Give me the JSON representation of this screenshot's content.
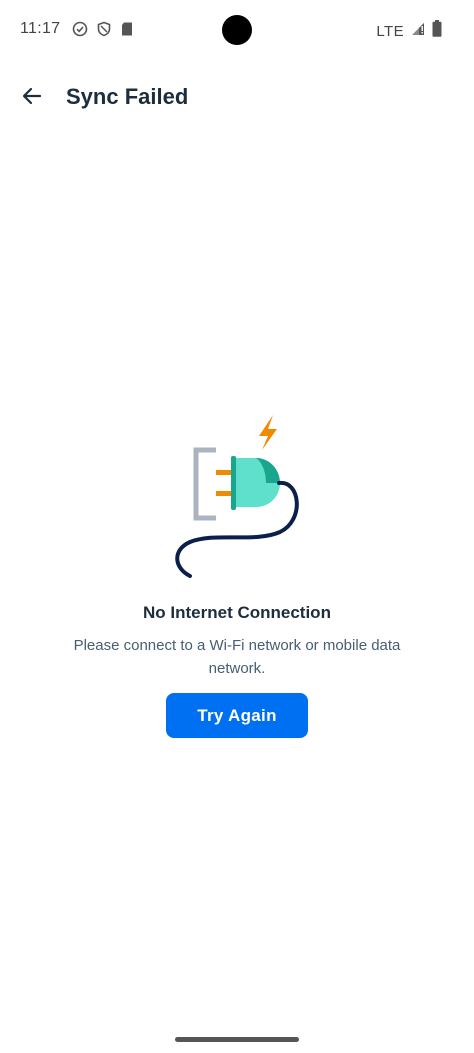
{
  "status_bar": {
    "time": "11:17",
    "network": "LTE",
    "icons": [
      "check-circle-icon",
      "shield-icon",
      "sd-card-icon",
      "signal-icon",
      "battery-icon"
    ]
  },
  "app_bar": {
    "back_icon": "arrow-left-icon",
    "title": "Sync Failed"
  },
  "empty_state": {
    "illustration": "unplugged-cable-icon",
    "title": "No Internet Connection",
    "description": "Please connect to a Wi-Fi network or mobile data network.",
    "action_label": "Try Again"
  },
  "colors": {
    "primary": "#0070f2",
    "title_text": "#1d2d3e",
    "body_text": "#475e75",
    "plug_teal": "#5ee0cc",
    "plug_dark_teal": "#1aa68c",
    "bolt_orange": "#f08a00",
    "cable_navy": "#0b1f4a"
  }
}
